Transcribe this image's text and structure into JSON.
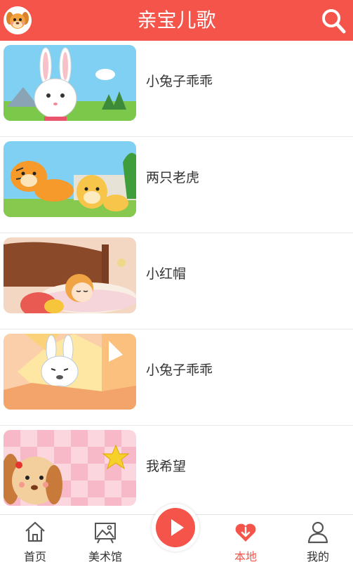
{
  "app": {
    "title": "亲宝儿歌",
    "accent_color": "#f5544a",
    "logo_icon": "puppy-logo-icon",
    "search_icon": "search-icon"
  },
  "songs": [
    {
      "name": "小兔子乖乖",
      "thumb_icon": "white-rabbit-thumbnail"
    },
    {
      "name": "两只老虎",
      "thumb_icon": "two-tigers-thumbnail"
    },
    {
      "name": "小红帽",
      "thumb_icon": "girl-sleeping-thumbnail"
    },
    {
      "name": "小兔子乖乖",
      "thumb_icon": "crying-rabbit-thumbnail"
    },
    {
      "name": "我希望",
      "thumb_icon": "puppy-star-thumbnail"
    }
  ],
  "nav": {
    "items": [
      {
        "label": "首页",
        "icon": "home-icon"
      },
      {
        "label": "美术馆",
        "icon": "picture-icon"
      },
      {
        "label": "本地",
        "icon": "heart-download-icon",
        "active": true
      },
      {
        "label": "我的",
        "icon": "user-icon"
      }
    ],
    "center_icon": "play-icon"
  }
}
